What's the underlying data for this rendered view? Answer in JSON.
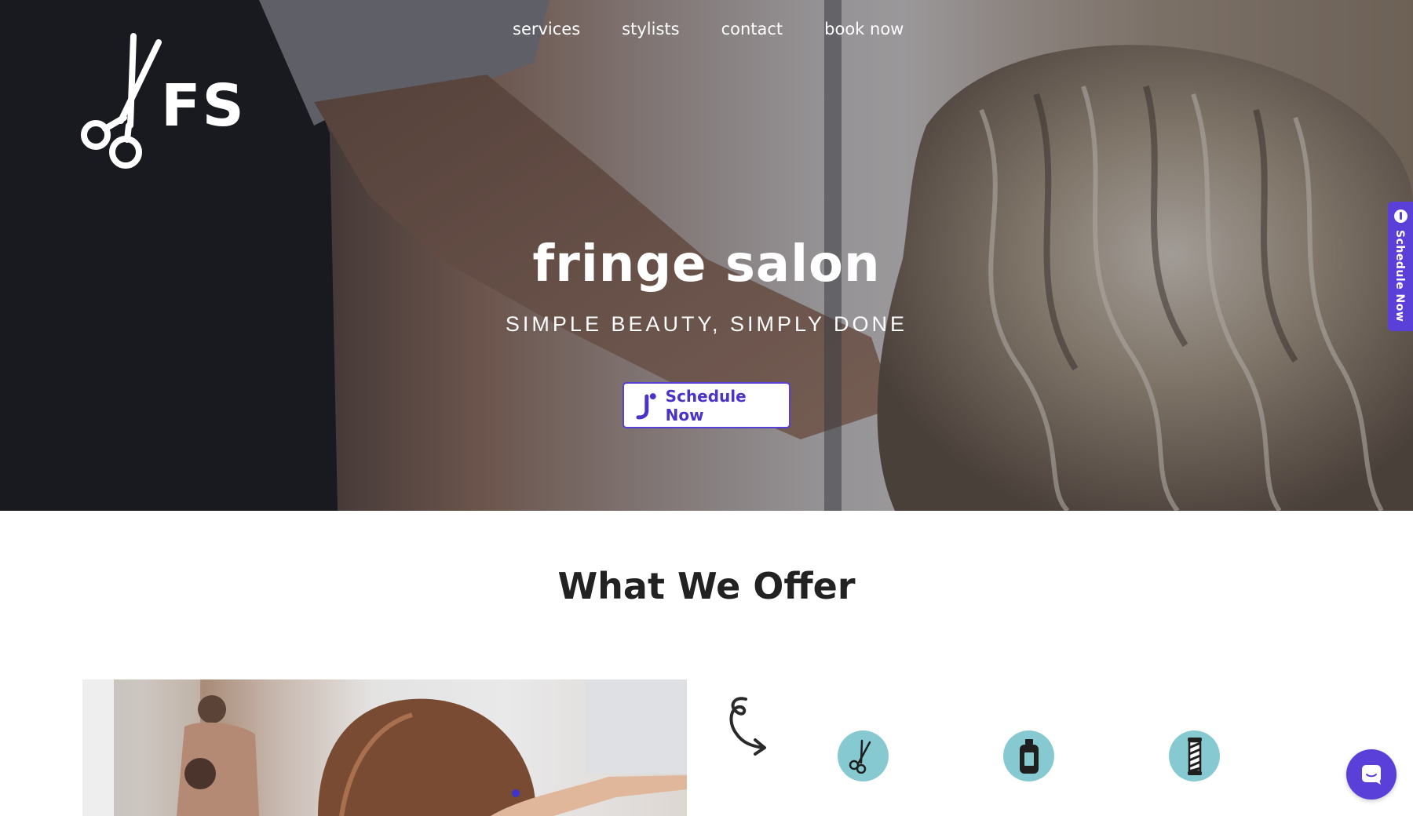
{
  "nav": {
    "items": [
      {
        "label": "services"
      },
      {
        "label": "stylists"
      },
      {
        "label": "contact"
      },
      {
        "label": "book now"
      }
    ]
  },
  "logo": {
    "text": "FS",
    "icon": "scissors-icon"
  },
  "hero": {
    "title": "fringe salon",
    "subtitle": "SIMPLE BEAUTY, SIMPLY DONE",
    "cta_label": "Schedule Now"
  },
  "side_tab": {
    "label": "Schedule Now"
  },
  "offer": {
    "title": "What We Offer",
    "icons": [
      "scissors-icon",
      "product-bottle-icon",
      "barber-pole-icon"
    ]
  },
  "colors": {
    "accent": "#5a3fd8",
    "service_icon_bg": "#86c9d1",
    "heading": "#222222"
  }
}
